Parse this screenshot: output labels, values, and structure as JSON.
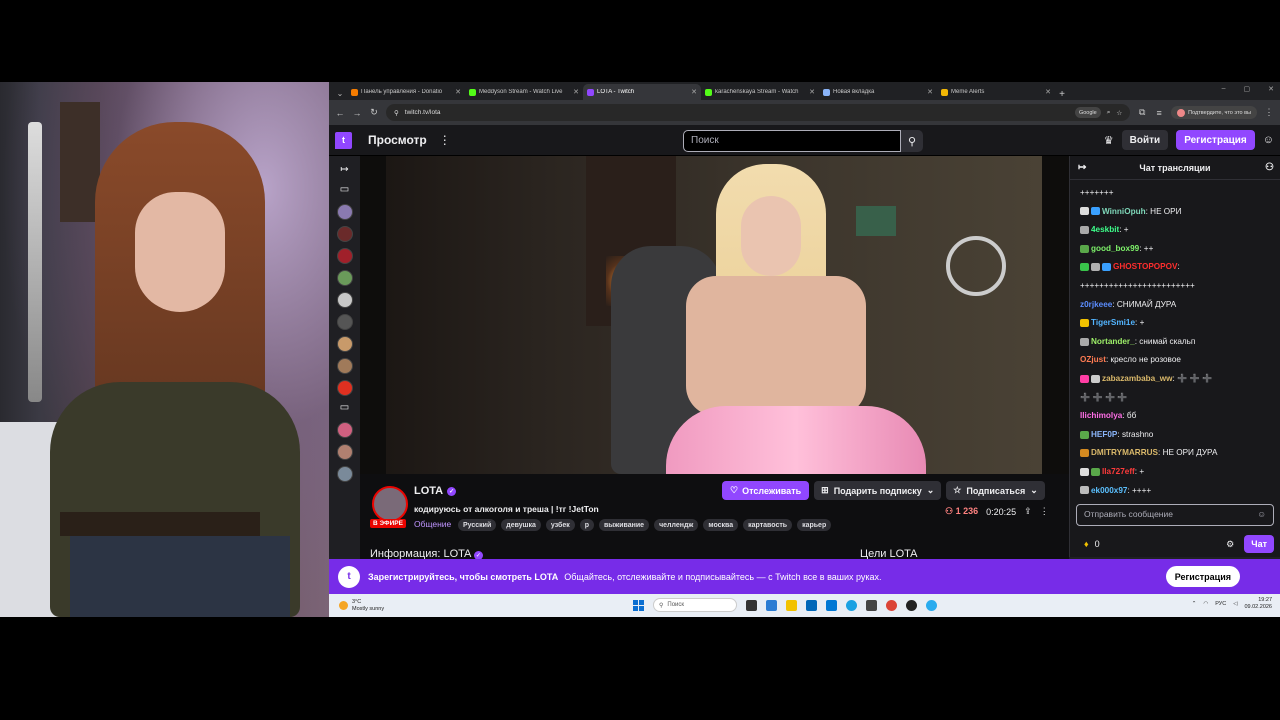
{
  "browser": {
    "tabs": [
      {
        "label": "Панель управления - Donatio",
        "color": "#f57c00",
        "active": false
      },
      {
        "label": "Meddyson Stream - Watch Live",
        "color": "#53fc18",
        "active": false
      },
      {
        "label": "LOTA - Twitch",
        "color": "#9147ff",
        "active": true
      },
      {
        "label": "karachenskaya Stream - Watch",
        "color": "#53fc18",
        "active": false
      },
      {
        "label": "Новая вкладка",
        "color": "#8ab4f8",
        "active": false
      },
      {
        "label": "Meme Alerts",
        "color": "#f2b705",
        "active": false
      }
    ],
    "url": "twitch.tv/lota",
    "google_label": "Google",
    "account_label": "Подтвердите, что это вы"
  },
  "twitch": {
    "nav_browse": "Просмотр",
    "search_placeholder": "Поиск",
    "login": "Войти",
    "signup": "Регистрация"
  },
  "channel": {
    "name": "LOTA",
    "live": "В ЭФИРЕ",
    "title": "кодируюсь от алкоголя и треша | !тг !JetTon",
    "category": "Общение",
    "tags": [
      "Русский",
      "девушка",
      "узбек",
      "р",
      "выживание",
      "челлендж",
      "москва",
      "картавость",
      "карьер"
    ],
    "follow": "Отслеживать",
    "gift": "Подарить подписку",
    "subscribe": "Подписаться",
    "viewers": "1 236",
    "uptime": "0:20:25",
    "about": "Информация: LOTA",
    "goals": "Цели LOTA"
  },
  "chat": {
    "header": "Чат трансляции",
    "messages": [
      {
        "user": "",
        "text": "+++++++",
        "color": "#efeff1",
        "badges": []
      },
      {
        "user": "WinniOpuh",
        "text": "НЕ ОРИ",
        "color": "#7ed6b8",
        "badges": [
          "#dddddd",
          "#3aa0ff"
        ]
      },
      {
        "user": "4eskbit",
        "text": "+",
        "color": "#3dff8a",
        "badges": [
          "#aaaaaa"
        ]
      },
      {
        "user": "good_box99",
        "text": "++",
        "color": "#7ef26a",
        "badges": [
          "#5aa84a"
        ]
      },
      {
        "user": "GHOSTOPOPOV",
        "text": "",
        "color": "#ff2d2d",
        "badges": [
          "#39c34b",
          "#b0b0b0",
          "#3aa0ff"
        ]
      },
      {
        "user": "",
        "text": "++++++++++++++++++++++++",
        "color": "#efeff1",
        "badges": []
      },
      {
        "user": "z0rjkeee",
        "text": "СНИМАЙ ДУРА",
        "color": "#5b8dff",
        "badges": []
      },
      {
        "user": "TigerSmi1e",
        "text": "+",
        "color": "#53b5ff",
        "badges": [
          "#f2c200"
        ]
      },
      {
        "user": "Nortander_",
        "text": "снимай скальп",
        "color": "#9ef069",
        "badges": [
          "#aaaaaa"
        ]
      },
      {
        "user": "OZjust",
        "text": "кресло не розовое",
        "color": "#ff7b52",
        "badges": []
      },
      {
        "user": "zabazambaba_ww",
        "text": "➕ ➕ ➕",
        "color": "#d9b86a",
        "badges": [
          "#ff3ea5",
          "#cccccc"
        ]
      },
      {
        "user": "",
        "text": "➕ ➕ ➕ ➕",
        "color": "#ff2d2d",
        "badges": []
      },
      {
        "user": "llichimolya",
        "text": "бб",
        "color": "#ff6ee6",
        "badges": []
      },
      {
        "user": "HEF0P",
        "text": "strashno",
        "color": "#8ab4f8",
        "badges": [
          "#5aa84a"
        ]
      },
      {
        "user": "DMITRYMARRUS",
        "text": "НЕ ОРИ ДУРА",
        "color": "#d9b86a",
        "badges": [
          "#d48a20"
        ]
      },
      {
        "user": "lla727eff",
        "text": "+",
        "color": "#ff3b3b",
        "badges": [
          "#dddddd",
          "#5aa84a"
        ]
      },
      {
        "user": "ek000x97",
        "text": "++++",
        "color": "#5bc0ff",
        "badges": [
          "#bbbbbb"
        ]
      }
    ],
    "input_placeholder": "Отправить сообщение",
    "points": "0",
    "chat_button": "Чат"
  },
  "banner": {
    "bold": "Зарегистрируйтесь, чтобы смотреть LOTA",
    "text": "Общайтесь, отслеживайте и подписывайтесь — с Twitch все в ваших руках.",
    "button": "Регистрация"
  },
  "taskbar": {
    "temp": "3°C",
    "weather": "Mostly sunny",
    "search": "Поиск",
    "lang": "РУС",
    "time": "19:27",
    "date": "09.02.2026"
  }
}
